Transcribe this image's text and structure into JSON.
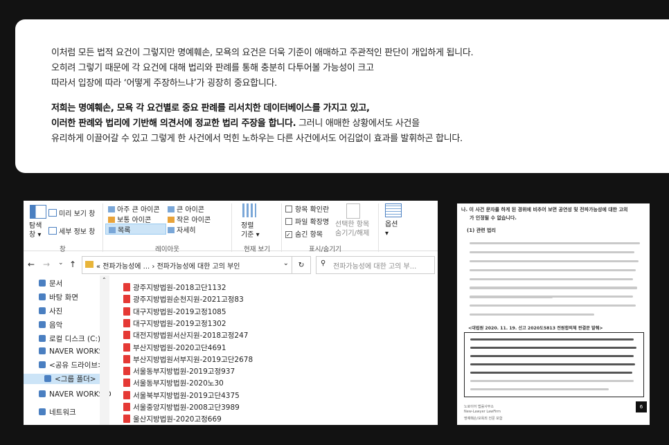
{
  "intro": {
    "p1": [
      "이처럼 모든 법적 요건이 그렇지만 명예훼손, 모욕의 요건은 더욱 기준이 애매하고 주관적인 판단이 개입하게 됩니다.",
      "오히려 그렇기 때문에 각 요건에 대해 법리와 판례를 통해 충분히 다투어볼 가능성이 크고",
      "따라서 입장에 따라 ‘어떻게 주장하느냐’가 굉장히 중요합니다."
    ],
    "p2_bold1": "저희는 명예훼손, 모욕 각 요건별로 중요 판례를 리서치한 데이터베이스를 가지고 있고,",
    "p2_bold2": "이러한 판례와 법리에 기반해 의견서에 정교한 법리 주장을 합니다.",
    "p2_rest2": " 그러니 애매한 상황에서도 사건을",
    "p2_line3": "유리하게 이끌어갈 수 있고 그렇게 한 사건에서 먹힌 노하우는 다른 사건에서도 어김없이 효과를 발휘하곤 합니다."
  },
  "ribbon": {
    "nav_pane": "탐색\n창 ▾",
    "preview": "미리 보기 창",
    "details": "세부 정보 창",
    "group_pane": "창",
    "xl_icons": "아주 큰 아이콘",
    "lg_icons": "큰 아이콘",
    "md_icons": "보통 아이콘",
    "sm_icons": "작은 아이콘",
    "list": "목록",
    "detail_view": "자세히",
    "group_layout": "레이아웃",
    "sort": "정렬\n기준 ▾",
    "group_view": "현재 보기",
    "chk_item": "항목 확인란",
    "chk_ext": "파일 확장명",
    "chk_hidden": "숨긴 항목",
    "hide_sel": "선택한 항목\n숨기기/해제",
    "group_show": "표시/숨기기",
    "options": "옵션\n▾"
  },
  "address": {
    "path": "« 전파가능성에 ... › 전파가능성에 대한 고의 부인",
    "search_placeholder": "전파가능성에 대한 고의 부..."
  },
  "nav": [
    {
      "label": "문서",
      "icon": "document-icon"
    },
    {
      "label": "바탕 화면",
      "icon": "desktop-icon"
    },
    {
      "label": "사진",
      "icon": "picture-icon"
    },
    {
      "label": "음악",
      "icon": "music-icon"
    },
    {
      "label": "로컬 디스크 (C:)",
      "icon": "disk-icon"
    },
    {
      "label": "NAVER WORKS",
      "icon": "cloud-icon"
    },
    {
      "label": "<공유 드라이브>",
      "icon": "shared-drive-icon"
    },
    {
      "label": "<그룹 폴더>",
      "icon": "group-folder-icon"
    },
    {
      "label": "NAVER WORKS D",
      "icon": "cloud-icon"
    },
    {
      "label": "네트워크",
      "icon": "network-icon"
    }
  ],
  "files": [
    "광주지방법원-2018고단1132",
    "광주지방법원순천지원-2021고정83",
    "대구지방법원-2019고정1085",
    "대구지방법원-2019고정1302",
    "대전지방법원서산지원-2018고정247",
    "부산지방법원-2020고단4691",
    "부산지방법원서부지원-2019고단2678",
    "서울동부지방법원-2019고정937",
    "서울동부지방법원-2020노30",
    "서울북부지방법원-2019고단4375",
    "서울중앙지방법원-2008고단3989",
    "울산지방법원-2020고정669"
  ],
  "doc": {
    "heading1": "나. 이 사건 문자를 하게 된 경위에 비추어 보면 공연성 및 전파가능성에 대한 고의",
    "heading2": "가 인정될 수 없습니다.",
    "section": "(1) 관련 법리",
    "case_title": "<대법원 2020. 11. 19. 선고 2020도5813 전원합의체 판결문 발췌>",
    "page": "6",
    "footer1": "노로이어 법률사무소",
    "footer2": "New-Lawyer LawFirm",
    "footer3": "명예훼손/모욕죄 전문 포함"
  },
  "colors": {
    "background": "#121212",
    "pdf_red": "#e53935"
  }
}
